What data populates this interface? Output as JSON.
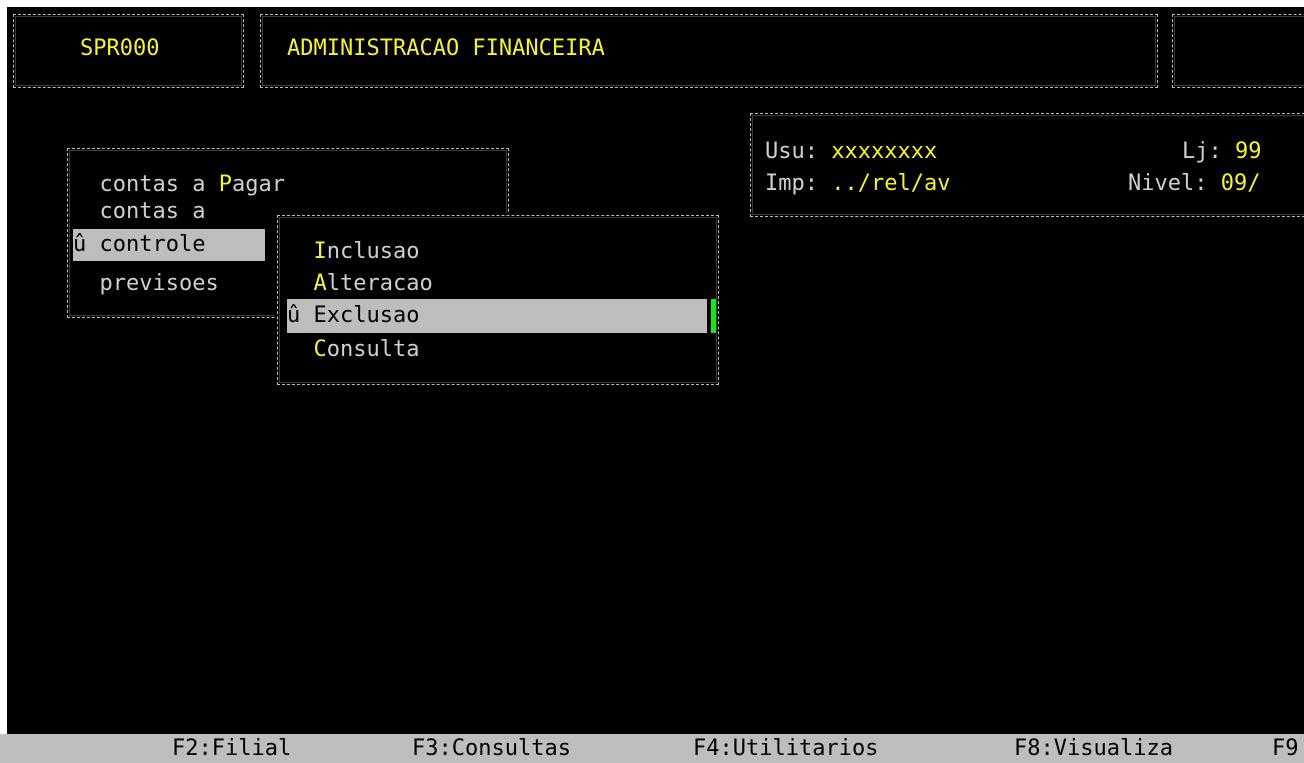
{
  "header": {
    "program_code": "SPR000",
    "module_title": "ADMINISTRACAO FINANCEIRA"
  },
  "info_panel": {
    "user_label": "Usu: ",
    "user_value": "xxxxxxxx",
    "store_label": "Lj: ",
    "store_value": "99",
    "printer_label": "Imp: ",
    "printer_value": "../rel/av",
    "level_label": "Nivel: ",
    "level_value": "09/"
  },
  "main_menu": {
    "items": [
      {
        "prefix": "  contas a ",
        "hotkey": "P",
        "rest": "agar",
        "selected": false
      },
      {
        "prefix": "  contas a ",
        "hotkey": "",
        "rest": "",
        "selected": false
      },
      {
        "prefix": "û controle",
        "hotkey": "",
        "rest": "",
        "selected": true
      },
      {
        "prefix": "  previsoes",
        "hotkey": "",
        "rest": "",
        "selected": false
      }
    ]
  },
  "sub_menu": {
    "items": [
      {
        "marker": "  ",
        "hotkey": "I",
        "rest": "nclusao",
        "selected": false
      },
      {
        "marker": "  ",
        "hotkey": "A",
        "rest": "lteracao",
        "selected": false
      },
      {
        "marker": "û ",
        "hotkey": "E",
        "rest": "xclusao",
        "selected": true
      },
      {
        "marker": "  ",
        "hotkey": "C",
        "rest": "onsulta",
        "selected": false
      }
    ]
  },
  "status_bar": {
    "keys": [
      "F2:Filial",
      "F3:Consultas",
      "F4:Utilitarios",
      "F8:Visualiza",
      "F9"
    ]
  },
  "colors": {
    "background": "#000000",
    "text": "#cfcfcf",
    "hotkey": "#f5f232",
    "highlight": "#bdbdbd",
    "cursor": "#19e619"
  }
}
